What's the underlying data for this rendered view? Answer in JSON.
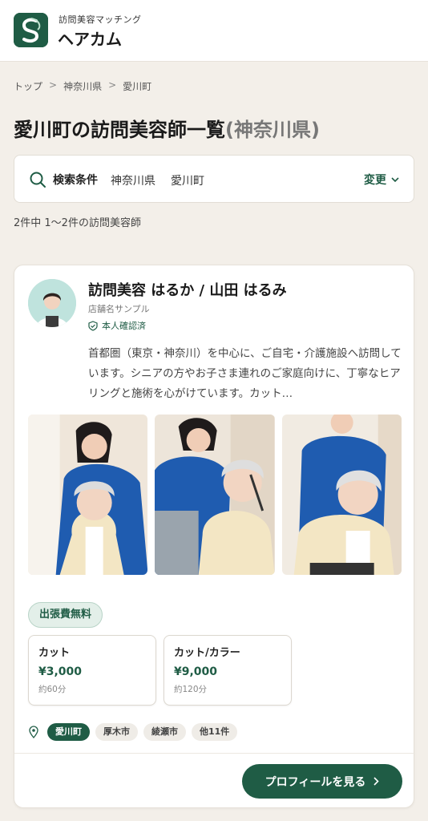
{
  "header": {
    "brand_sub": "訪問美容マッチング",
    "brand_name": "ヘアカム",
    "logo_icon": "leaf-s-logo"
  },
  "breadcrumb": {
    "items": [
      "トップ",
      "神奈川県",
      "愛川町"
    ],
    "separator": ">"
  },
  "page": {
    "title_main": "愛川町の訪問美容師一覧",
    "title_pref": "(神奈川県)"
  },
  "search": {
    "label": "検索条件",
    "prefecture": "神奈川県",
    "city": "愛川町",
    "change_label": "変更"
  },
  "result_count": "2件中 1〜2件の訪問美容師",
  "card": {
    "name": "訪問美容 はるか / 山田 はるみ",
    "shop": "店舗名サンプル",
    "verified_label": "本人確認済",
    "intro": "首都圏（東京・神奈川）を中心に、ご自宅・介護施設へ訪問しています。シニアの方やお子さま連れのご家庭向けに、丁寧なヒアリングと施術を心がけています。カット…",
    "free_badge": "出張費無料",
    "menus": [
      {
        "name": "カット",
        "price": "¥3,000",
        "time": "約60分"
      },
      {
        "name": "カット/カラー",
        "price": "¥9,000",
        "time": "約120分"
      }
    ],
    "areas": [
      "愛川町",
      "厚木市",
      "綾瀬市",
      "他11件"
    ],
    "profile_button": "プロフィールを見る"
  },
  "colors": {
    "brand_green": "#1f5c45",
    "background": "#f3efe9"
  }
}
